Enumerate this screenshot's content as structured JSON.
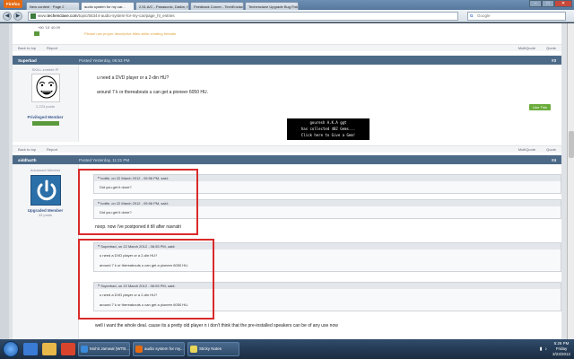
{
  "browser": {
    "app_button": "Firefox",
    "tabs": [
      {
        "label": "New content · Page 2"
      },
      {
        "label": "audio system for my car..."
      },
      {
        "label": "2.51 A/C - Panasonic, Daikin, Hitachi..."
      },
      {
        "label": "Feedback Corner - TechEnclave"
      },
      {
        "label": "Techenclave Upgrade Bug Fixing Th..."
      }
    ],
    "url_prefix": "www.",
    "url_domain": "techenclave.com",
    "url_rest": "/topic/55344-audio-system-for-my-car/page_hl_entries",
    "search_placeholder": "Google",
    "search_icon": "G"
  },
  "page": {
    "top_user_posts": "+60 '10' 40.09",
    "top_hint": "Please use proper descriptive titles while creating threads.",
    "link_bar": {
      "back_to_top": "Back to top",
      "report": "Report",
      "multiquote": "MultiQuote",
      "quote": "Quote"
    },
    "posts": [
      {
        "author": "Superbad",
        "date": "Posted Yesterday, 06:53 PM",
        "number": "#3",
        "user_title": "SKILL zombie IP",
        "posts_count": "2,223 posts",
        "rank": "Privileged Member",
        "message_1": "u need a DVD player or a 2-din HU?",
        "message_2": "around 7 k or thereabouts u can get a pioneer 6050 HU.",
        "like": "Like This",
        "signature": [
          "gouresh A.K.A ggt",
          "has collected 402 Gems...",
          "Click here to Give a Gem!"
        ]
      },
      {
        "author": "siddharth",
        "date": "Posted Yesterday, 11:21 PM",
        "number": "#4",
        "user_title": "Advanced Member",
        "rank": "Upgraded Member",
        "posts_count": "43 posts",
        "quotes": [
          {
            "head": "bottle, on 22 March 2012 - 09:56 PM, said:",
            "body": "Did you get it done?"
          },
          {
            "head": "bottle, on 22 March 2012 - 09:56 PM, said:",
            "body": "Did you get it done?"
          }
        ],
        "reply_1": "noop. now i've postponed it till after navratri",
        "quotes_2": [
          {
            "head": "Superbad, on 22 March 2012 - 06:53 PM, said:",
            "line1": "u need a DVD player or a 2-din HU?",
            "line2": "around 7 k or thereabouts u can get a pioneer 6050 HU."
          },
          {
            "head": "Superbad, on 22 March 2012 - 06:53 PM, said:",
            "line1": "u need a DVD player or a 2-din HU?",
            "line2": "around 7 k or thereabouts u can get a pioneer 6050 HU."
          }
        ],
        "reply_2": "well i want the whole deal. cause its a pretty old player n i don't think that the pre-installed speakers can be of any use now"
      }
    ]
  },
  "taskbar": {
    "tasks": [
      {
        "label": "Mohit Jamwal (WTB...",
        "color": "#3b8ad9"
      },
      {
        "label": "audio system for my...",
        "color": "#e46b14"
      },
      {
        "label": "Sticky Notes",
        "color": "#e8d75a"
      }
    ],
    "time": "5:26 PM",
    "day": "Friday",
    "date": "3/23/2012"
  }
}
